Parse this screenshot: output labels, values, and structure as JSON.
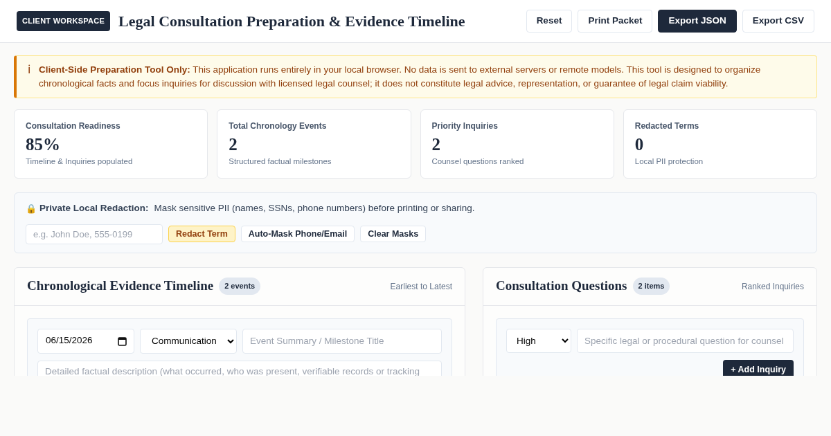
{
  "header": {
    "badge": "CLIENT WORKSPACE",
    "title": "Legal Consultation Preparation & Evidence Timeline",
    "buttons": [
      {
        "label": "Reset",
        "kind": "outline"
      },
      {
        "label": "Print Packet",
        "kind": "outline"
      },
      {
        "label": "Export JSON",
        "kind": "primary"
      },
      {
        "label": "Export CSV",
        "kind": "outline"
      }
    ]
  },
  "notice": {
    "icon": "ℹ",
    "text": "**Client-Side Preparation Tool Only:** This application runs entirely in your local browser. No data is sent to external servers or remote models. This tool is designed to organize chronological facts and focus inquiries for discussion with licensed legal counsel; it does not constitute legal advice, representation, or guarantee of legal claim viability."
  },
  "stats": [
    {
      "label": "Consultation Readiness",
      "value": "85%",
      "note": "Timeline & Inquiries populated"
    },
    {
      "label": "Total Chronology Events",
      "value": "2",
      "note": "Structured factual milestones"
    },
    {
      "label": "Priority Inquiries",
      "value": "2",
      "note": "Counsel questions ranked"
    },
    {
      "label": "Redacted Terms",
      "value": "0",
      "note": "Local PII protection"
    }
  ],
  "redaction": {
    "icon": "🔒",
    "title": "Private Local Redaction:",
    "description": "Mask sensitive PII (names, SSNs, phone numbers) before printing or sharing.",
    "placeholder": "e.g. John Doe, 555-0199",
    "buttons": [
      {
        "label": "Redact Term",
        "kind": "accent"
      },
      {
        "label": "Auto-Mask Phone/Email",
        "kind": "outline"
      },
      {
        "label": "Clear Masks",
        "kind": "outline"
      }
    ]
  },
  "timeline": {
    "title": "Chronological Evidence Timeline",
    "count": "2 events",
    "order": "Earliest to Latest",
    "date": "06/15/2026",
    "category": "Communication",
    "summary_placeholder": "Event Summary / Milestone Title",
    "description_placeholder": "Detailed factual description (what occurred, who was present, verifiable records or tracking"
  },
  "questions": {
    "title": "Consultation Questions",
    "count": "2 items",
    "order": "Ranked Inquiries",
    "priority": "High",
    "question_placeholder": "Specific legal or procedural question for counsel",
    "add_button": "+ Add Inquiry"
  }
}
